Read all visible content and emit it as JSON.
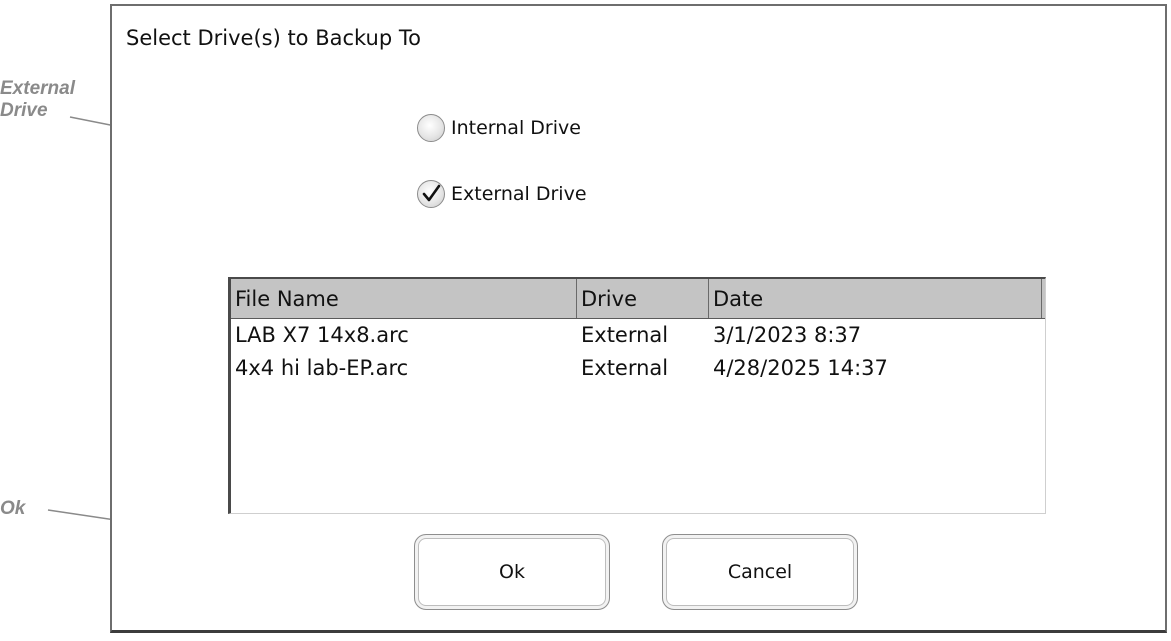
{
  "annotations": {
    "external_drive": "External Drive",
    "ok": "Ok"
  },
  "dialog": {
    "title": "Select Drive(s) to Backup To",
    "options": [
      {
        "label": "Internal Drive",
        "checked": false
      },
      {
        "label": "External Drive",
        "checked": true
      }
    ],
    "file_list": {
      "columns": [
        "File Name",
        "Drive",
        "Date"
      ],
      "rows": [
        [
          "LAB X7 14x8.arc",
          "External",
          "3/1/2023 8:37"
        ],
        [
          "4x4 hi lab-EP.arc",
          "External",
          "4/28/2025 14:37"
        ]
      ]
    },
    "buttons": {
      "ok": "Ok",
      "cancel": "Cancel"
    }
  },
  "colors": {
    "callout": "#8a8a8a",
    "header_bg": "#c4c4c4"
  }
}
